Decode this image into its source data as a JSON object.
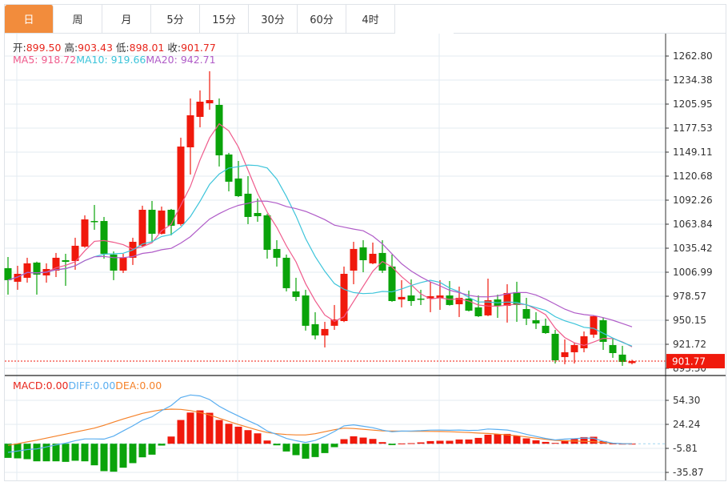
{
  "tabs": [
    {
      "label": "日",
      "active": true
    },
    {
      "label": "周"
    },
    {
      "label": "月"
    },
    {
      "label": "5分"
    },
    {
      "label": "15分"
    },
    {
      "label": "30分"
    },
    {
      "label": "60分"
    },
    {
      "label": "4时"
    }
  ],
  "ohlc_legend": {
    "open_label": "开:",
    "open": "899.50",
    "high_label": "高:",
    "high": "903.43",
    "low_label": "低:",
    "low": "898.01",
    "close_label": "收:",
    "close": "901.77"
  },
  "ma_legend": {
    "ma5": "MA5: 918.72",
    "ma10": "MA10: 919.66",
    "ma20": "MA20: 942.71"
  },
  "macd_legend": {
    "macd": "MACD:0.00",
    "diff": "DIFF:0.00",
    "dea": "DEA:0.00"
  },
  "current_price": "901.77",
  "colors": {
    "up": "#f0190c",
    "down": "#0aa30a",
    "ma5": "#ef5b8c",
    "ma10": "#3cc4da",
    "ma20": "#b05cc8",
    "diff": "#5aaef0",
    "dea": "#f5822a",
    "active_tab": "#f28c3c"
  },
  "chart_data": [
    {
      "type": "candlestick",
      "price_ticks": [
        "1262.80",
        "1234.38",
        "1205.95",
        "1177.53",
        "1149.11",
        "1120.68",
        "1092.26",
        "1063.84",
        "1035.42",
        "1006.99",
        "978.57",
        "950.15",
        "921.72",
        "893.30"
      ],
      "ylim": [
        893.3,
        1262.8
      ],
      "grid": true,
      "ma_periods": [
        5,
        10,
        20
      ],
      "ohlc": [
        [
          1011.8,
          1025.0,
          980.5,
          997.6
        ],
        [
          995.7,
          1014.6,
          986.2,
          1005.1
        ],
        [
          1000.4,
          1024.1,
          994.7,
          1017.5
        ],
        [
          1018.4,
          1019.5,
          980.5,
          1004.2
        ],
        [
          1003.2,
          1017.5,
          994.7,
          1010.8
        ],
        [
          1008.9,
          1029.8,
          1001.3,
          1024.1
        ],
        [
          1021.2,
          1028.8,
          990.9,
          1019.3
        ],
        [
          1020.3,
          1047.8,
          1009.9,
          1038.3
        ],
        [
          1037.3,
          1074.3,
          1036.0,
          1069.5
        ],
        [
          1067.6,
          1086.6,
          1057.2,
          1066.7
        ],
        [
          1067.6,
          1072.4,
          1023.1,
          1028.8
        ],
        [
          1027.9,
          1031.6,
          997.6,
          1008.9
        ],
        [
          1008.9,
          1028.8,
          1006.1,
          1024.1
        ],
        [
          1024.1,
          1047.8,
          1015.6,
          1043.0
        ],
        [
          1038.3,
          1085.7,
          1036.5,
          1080.9
        ],
        [
          1080.9,
          1091.3,
          1043.0,
          1052.5
        ],
        [
          1052.5,
          1084.7,
          1051.6,
          1080.0
        ],
        [
          1080.9,
          1081.9,
          1050.6,
          1062.0
        ],
        [
          1063.9,
          1166.2,
          1062.0,
          1155.7
        ],
        [
          1154.8,
          1212.6,
          1122.6,
          1192.7
        ],
        [
          1190.8,
          1222.1,
          1178.5,
          1208.8
        ],
        [
          1206.9,
          1244.8,
          1199.3,
          1210.7
        ],
        [
          1205.0,
          1212.6,
          1132.1,
          1145.3
        ],
        [
          1146.3,
          1148.2,
          1102.7,
          1114.1
        ],
        [
          1117.9,
          1138.7,
          1096.0,
          1097.0
        ],
        [
          1099.9,
          1120.7,
          1063.9,
          1072.4
        ],
        [
          1077.1,
          1094.2,
          1066.7,
          1073.3
        ],
        [
          1074.3,
          1076.2,
          1023.1,
          1033.5
        ],
        [
          1034.5,
          1044.9,
          1013.7,
          1024.1
        ],
        [
          1024.1,
          1027.9,
          984.3,
          988.1
        ],
        [
          984.3,
          1000.4,
          972.9,
          977.7
        ],
        [
          979.5,
          986.2,
          937.9,
          943.6
        ],
        [
          945.5,
          959.7,
          927.5,
          932.2
        ],
        [
          932.2,
          948.3,
          918.0,
          939.8
        ],
        [
          943.6,
          968.2,
          938.8,
          951.1
        ],
        [
          949.2,
          1013.7,
          948.0,
          1005.1
        ],
        [
          1008.9,
          1043.0,
          992.8,
          1034.5
        ],
        [
          1036.4,
          1044.9,
          1007.0,
          1021.2
        ],
        [
          1017.5,
          1042.1,
          1016.5,
          1028.8
        ],
        [
          1029.8,
          1044.9,
          1006.1,
          1008.9
        ],
        [
          1013.7,
          1027.9,
          972.0,
          972.9
        ],
        [
          974.8,
          997.6,
          965.4,
          977.7
        ],
        [
          979.5,
          998.5,
          967.2,
          972.9
        ],
        [
          975.8,
          986.2,
          968.2,
          974.8
        ],
        [
          975.8,
          995.7,
          959.7,
          978.6
        ],
        [
          976.7,
          997.6,
          962.5,
          979.5
        ],
        [
          979.5,
          996.6,
          967.5,
          968.2
        ],
        [
          969.1,
          990.0,
          954.0,
          976.7
        ],
        [
          975.8,
          985.2,
          960.6,
          961.5
        ],
        [
          965.4,
          979.5,
          954.0,
          954.9
        ],
        [
          955.9,
          999.4,
          955.0,
          973.9
        ],
        [
          974.8,
          980.5,
          953.0,
          967.2
        ],
        [
          967.2,
          992.8,
          947.4,
          982.4
        ],
        [
          983.3,
          995.7,
          948.3,
          968.2
        ],
        [
          963.4,
          976.7,
          944.5,
          952.1
        ],
        [
          950.2,
          959.7,
          939.8,
          946.4
        ],
        [
          943.6,
          952.1,
          934.0,
          935.0
        ],
        [
          934.1,
          938.8,
          899.0,
          902.8
        ],
        [
          906.6,
          927.5,
          898.1,
          912.3
        ],
        [
          912.3,
          923.7,
          899.0,
          920.8
        ],
        [
          917.0,
          936.9,
          912.3,
          931.2
        ],
        [
          933.1,
          955.5,
          929.4,
          954.9
        ],
        [
          950.2,
          953.0,
          915.1,
          924.6
        ],
        [
          920.8,
          928.4,
          905.7,
          911.3
        ],
        [
          909.5,
          919.9,
          896.2,
          900.9
        ],
        [
          899.5,
          903.43,
          898.01,
          901.77
        ]
      ]
    },
    {
      "type": "bar",
      "macd_ticks": [
        "54.30",
        "24.24",
        "-5.81",
        "-35.87"
      ],
      "ylim": [
        -35.87,
        54.3
      ],
      "macd": [
        -17.7,
        -18.3,
        -19.3,
        -22,
        -22,
        -22,
        -22.7,
        -21.3,
        -22,
        -27,
        -34.3,
        -35,
        -30,
        -24.3,
        -17,
        -13.7,
        -2.3,
        9,
        29.7,
        39,
        41.7,
        38.7,
        29.7,
        25,
        21.3,
        17,
        13,
        4,
        -2,
        -9.7,
        -14.3,
        -18.7,
        -16.7,
        -11.7,
        -4.3,
        5.7,
        9.3,
        7.7,
        6,
        2,
        -1.7,
        0.3,
        0.7,
        1.7,
        3.3,
        3.7,
        3.7,
        5.3,
        5.3,
        7.3,
        11.3,
        11.7,
        12.3,
        9.7,
        6.7,
        4.3,
        2.3,
        1,
        4.3,
        6,
        8.3,
        8.7,
        3.3,
        0.3,
        0,
        0
      ],
      "dea": [
        -2,
        0,
        2.3,
        4.5,
        7,
        9.5,
        12,
        14.5,
        17,
        19.5,
        23,
        27,
        31,
        34.5,
        38,
        40.5,
        42.5,
        43.3,
        43,
        41.5,
        39,
        36,
        32,
        28,
        24,
        20.5,
        17,
        14,
        12.5,
        11.5,
        11,
        11,
        12.5,
        15,
        17.5,
        19.5,
        19,
        18,
        17,
        16,
        15.8,
        15.7,
        15.6,
        15.5,
        15.4,
        15.3,
        15,
        14.5,
        14,
        13.3,
        12.8,
        12,
        11,
        10,
        8.5,
        7,
        5.5,
        4.2,
        3.7,
        3.3,
        3,
        2.5,
        1.5,
        0.5,
        0.1,
        0
      ]
    }
  ]
}
